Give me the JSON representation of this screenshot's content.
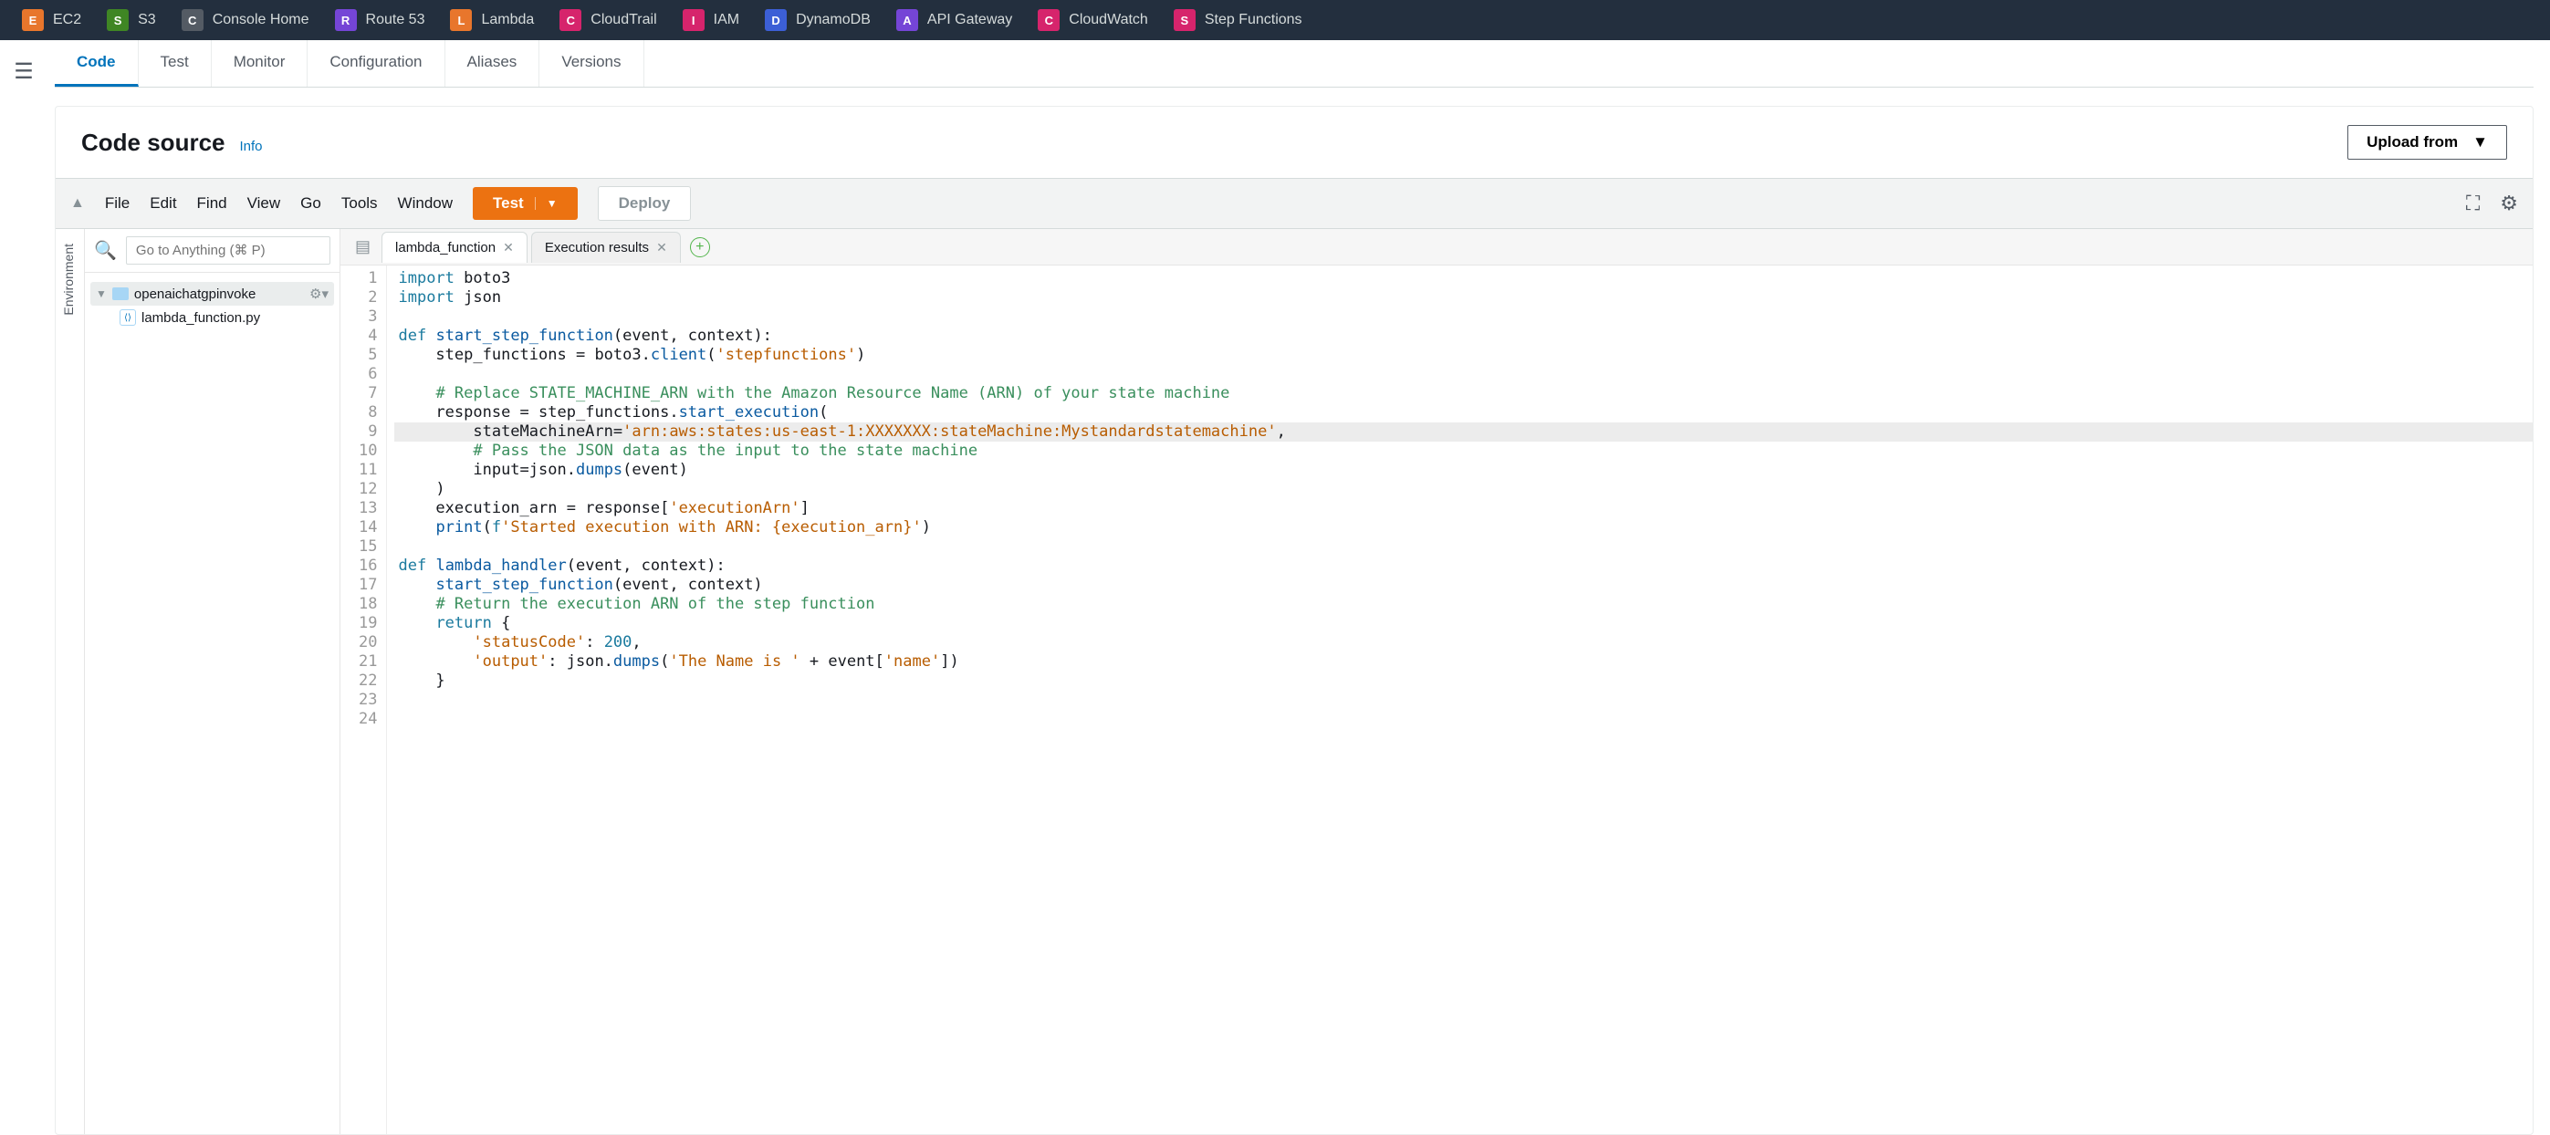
{
  "services": [
    {
      "name": "EC2",
      "color": "#e8762c"
    },
    {
      "name": "S3",
      "color": "#3f8624"
    },
    {
      "name": "Console Home",
      "color": "#545b64"
    },
    {
      "name": "Route 53",
      "color": "#7545d6"
    },
    {
      "name": "Lambda",
      "color": "#e8762c"
    },
    {
      "name": "CloudTrail",
      "color": "#d6246c"
    },
    {
      "name": "IAM",
      "color": "#d6246c"
    },
    {
      "name": "DynamoDB",
      "color": "#3c5fd6"
    },
    {
      "name": "API Gateway",
      "color": "#7545d6"
    },
    {
      "name": "CloudWatch",
      "color": "#d6246c"
    },
    {
      "name": "Step Functions",
      "color": "#d6246c"
    }
  ],
  "lambda_tabs": [
    "Code",
    "Test",
    "Monitor",
    "Configuration",
    "Aliases",
    "Versions"
  ],
  "lambda_tabs_active": 0,
  "card": {
    "title": "Code source",
    "info": "Info",
    "upload": "Upload from"
  },
  "ide_menu": [
    "File",
    "Edit",
    "Find",
    "View",
    "Go",
    "Tools",
    "Window"
  ],
  "ide_buttons": {
    "test": "Test",
    "deploy": "Deploy"
  },
  "panel": {
    "env": "Environment",
    "search_placeholder": "Go to Anything (⌘ P)",
    "folder": "openaichatgpinvoke",
    "file": "lambda_function.py"
  },
  "editor_tabs": [
    {
      "label": "lambda_function",
      "active": true
    },
    {
      "label": "Execution results",
      "active": false
    }
  ],
  "code": {
    "lines": 24,
    "highlight": 9,
    "tokens": [
      [
        [
          "kw",
          "import"
        ],
        [
          "",
          " boto3"
        ]
      ],
      [
        [
          "kw",
          "import"
        ],
        [
          "",
          " json"
        ]
      ],
      [
        [
          "",
          ""
        ]
      ],
      [
        [
          "kw",
          "def"
        ],
        [
          "",
          " "
        ],
        [
          "fn",
          "start_step_function"
        ],
        [
          "",
          "(event, context):"
        ]
      ],
      [
        [
          "",
          "    step_functions "
        ],
        [
          "op",
          "="
        ],
        [
          "",
          " boto3."
        ],
        [
          "fn",
          "client"
        ],
        [
          "",
          "("
        ],
        [
          "str",
          "'stepfunctions'"
        ],
        [
          "",
          ")"
        ]
      ],
      [
        [
          "",
          ""
        ]
      ],
      [
        [
          "",
          "    "
        ],
        [
          "cm",
          "# Replace STATE_MACHINE_ARN with the Amazon Resource Name (ARN) of your state machine"
        ]
      ],
      [
        [
          "",
          "    response "
        ],
        [
          "op",
          "="
        ],
        [
          "",
          " step_functions."
        ],
        [
          "fn",
          "start_execution"
        ],
        [
          "",
          "("
        ]
      ],
      [
        [
          "",
          "        stateMachineArn"
        ],
        [
          "op",
          "="
        ],
        [
          "str",
          "'arn:aws:states:us-east-1:XXXXXXX:stateMachine:Mystandardstatemachine'"
        ],
        [
          "",
          ","
        ]
      ],
      [
        [
          "",
          "        "
        ],
        [
          "cm",
          "# Pass the JSON data as the input to the state machine"
        ]
      ],
      [
        [
          "",
          "        input"
        ],
        [
          "op",
          "="
        ],
        [
          "",
          "json."
        ],
        [
          "fn",
          "dumps"
        ],
        [
          "",
          "(event)"
        ]
      ],
      [
        [
          "",
          "    )"
        ]
      ],
      [
        [
          "",
          "    execution_arn "
        ],
        [
          "op",
          "="
        ],
        [
          "",
          " response["
        ],
        [
          "str",
          "'executionArn'"
        ],
        [
          "",
          "]"
        ]
      ],
      [
        [
          "",
          "    "
        ],
        [
          "fn",
          "print"
        ],
        [
          "",
          "("
        ],
        [
          "kw",
          "f"
        ],
        [
          "str",
          "'Started execution with ARN: {execution_arn}'"
        ],
        [
          "",
          ")"
        ]
      ],
      [
        [
          "",
          ""
        ]
      ],
      [
        [
          "kw",
          "def"
        ],
        [
          "",
          " "
        ],
        [
          "fn",
          "lambda_handler"
        ],
        [
          "",
          "(event, context):"
        ]
      ],
      [
        [
          "",
          "    "
        ],
        [
          "fn",
          "start_step_function"
        ],
        [
          "",
          "(event, context)"
        ]
      ],
      [
        [
          "",
          "    "
        ],
        [
          "cm",
          "# Return the execution ARN of the step function"
        ]
      ],
      [
        [
          "",
          "    "
        ],
        [
          "kw",
          "return"
        ],
        [
          "",
          " {"
        ]
      ],
      [
        [
          "",
          "        "
        ],
        [
          "str",
          "'statusCode'"
        ],
        [
          "",
          ": "
        ],
        [
          "num",
          "200"
        ],
        [
          "",
          ","
        ]
      ],
      [
        [
          "",
          "        "
        ],
        [
          "str",
          "'output'"
        ],
        [
          "",
          ": json."
        ],
        [
          "fn",
          "dumps"
        ],
        [
          "",
          "("
        ],
        [
          "str",
          "'The Name is '"
        ],
        [
          "",
          " + event["
        ],
        [
          "str",
          "'name'"
        ],
        [
          "",
          "])"
        ]
      ],
      [
        [
          "",
          "    }"
        ]
      ],
      [
        [
          "",
          ""
        ]
      ],
      [
        [
          "",
          ""
        ]
      ]
    ]
  }
}
